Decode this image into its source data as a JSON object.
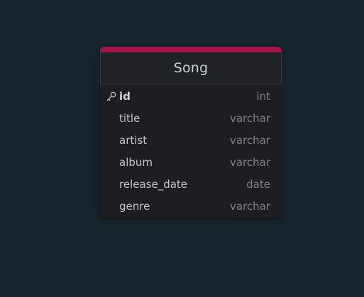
{
  "table": {
    "name": "Song",
    "accent_color": "#a21545",
    "columns": [
      {
        "name": "id",
        "type": "int",
        "primary_key": true,
        "icon": "key-icon"
      },
      {
        "name": "title",
        "type": "varchar"
      },
      {
        "name": "artist",
        "type": "varchar"
      },
      {
        "name": "album",
        "type": "varchar"
      },
      {
        "name": "release_date",
        "type": "date"
      },
      {
        "name": "genre",
        "type": "varchar"
      }
    ]
  }
}
